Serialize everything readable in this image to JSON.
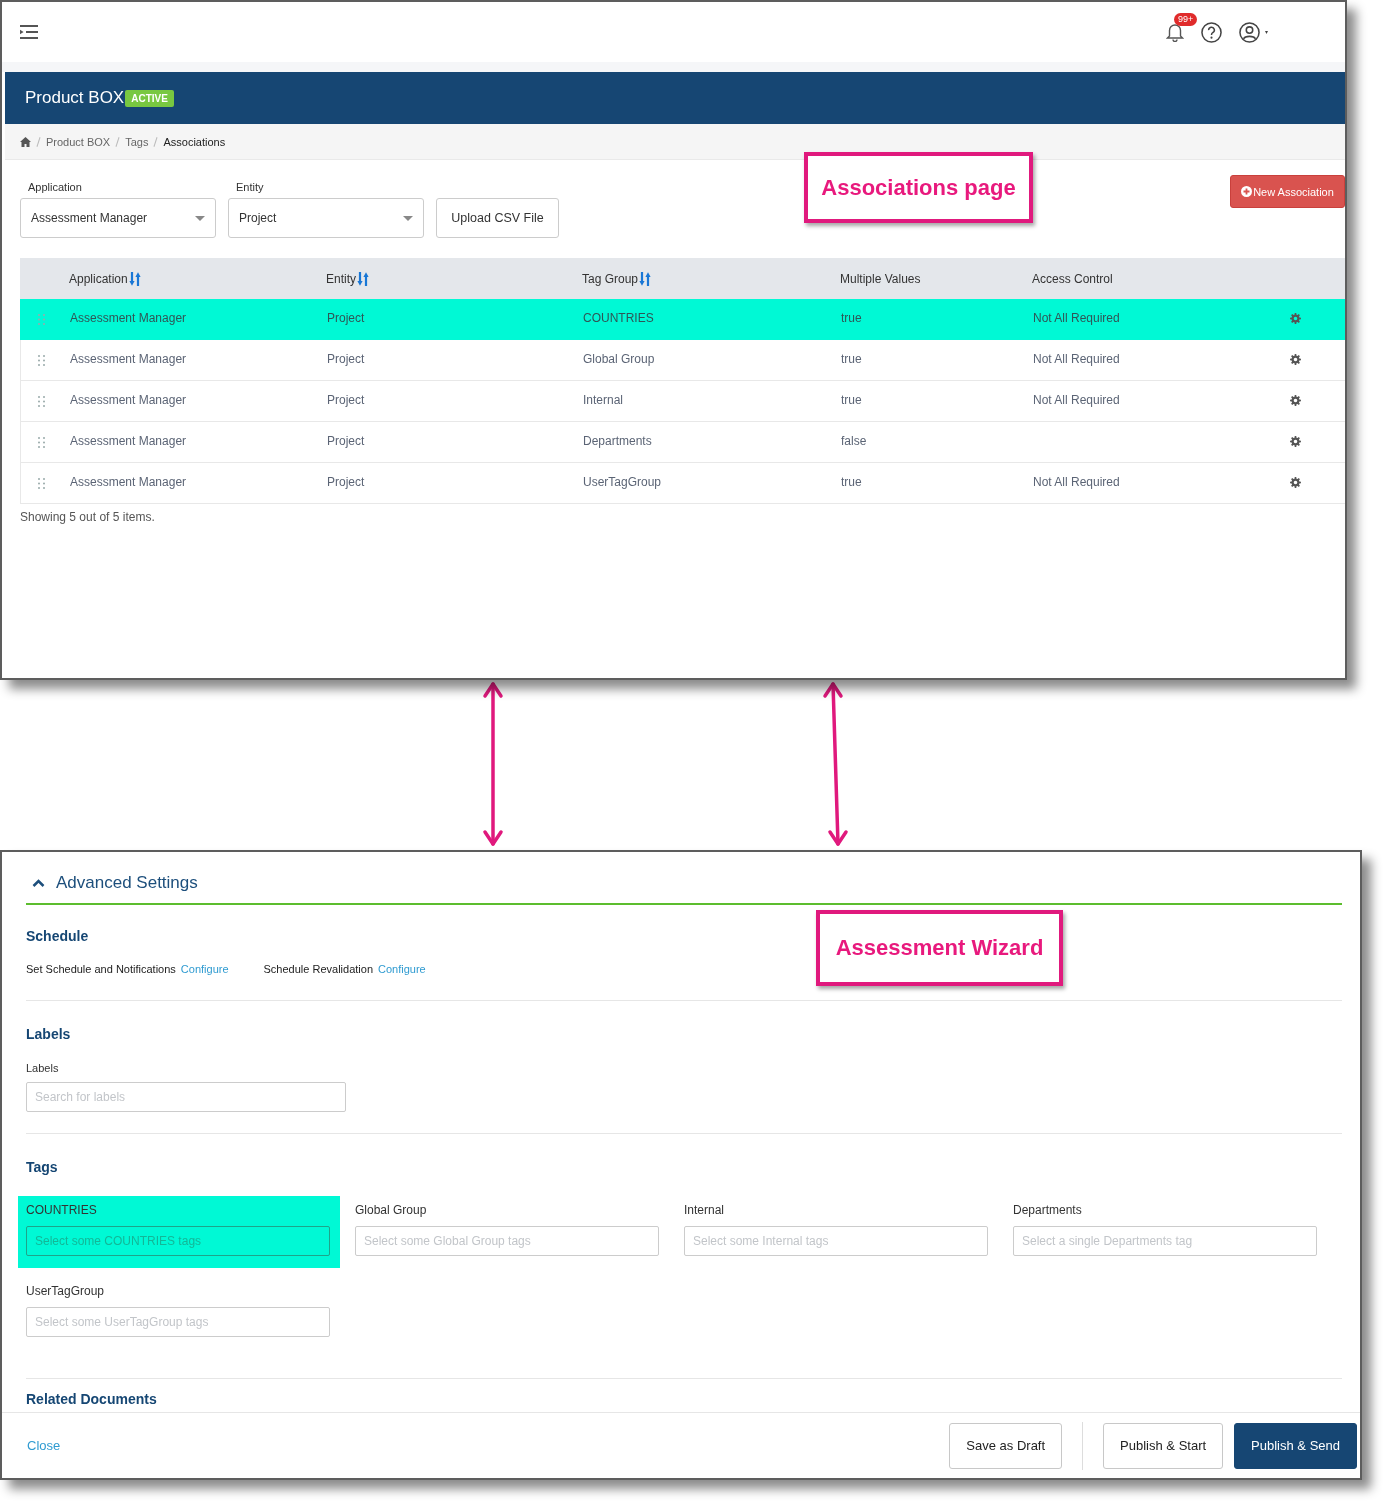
{
  "associations_page": {
    "annotation": "Associations page",
    "top_bar": {
      "notifications_badge": "99+"
    },
    "header": {
      "title": "Product BOX",
      "status": "ACTIVE"
    },
    "breadcrumb": [
      {
        "label": "Product BOX",
        "current": false
      },
      {
        "label": "Tags",
        "current": false
      },
      {
        "label": "Associations",
        "current": true
      }
    ],
    "filters": [
      {
        "label": "Application",
        "value": "Assessment Manager"
      },
      {
        "label": "Entity",
        "value": "Project"
      }
    ],
    "upload_button": "Upload CSV File",
    "new_association_button": "New Association",
    "table": {
      "columns": [
        {
          "label": "Application",
          "sortable": true
        },
        {
          "label": "Entity",
          "sortable": true
        },
        {
          "label": "Tag Group",
          "sortable": true
        },
        {
          "label": "Multiple Values",
          "sortable": false
        },
        {
          "label": "Access Control",
          "sortable": false
        }
      ],
      "rows": [
        {
          "highlighted": true,
          "application": "Assessment Manager",
          "entity": "Project",
          "tag_group": "COUNTRIES",
          "multiple_values": "true",
          "access_control": "Not All Required"
        },
        {
          "highlighted": false,
          "application": "Assessment Manager",
          "entity": "Project",
          "tag_group": "Global Group",
          "multiple_values": "true",
          "access_control": "Not All Required"
        },
        {
          "highlighted": false,
          "application": "Assessment Manager",
          "entity": "Project",
          "tag_group": "Internal",
          "multiple_values": "true",
          "access_control": "Not All Required"
        },
        {
          "highlighted": false,
          "application": "Assessment Manager",
          "entity": "Project",
          "tag_group": "Departments",
          "multiple_values": "false"
        },
        {
          "highlighted": false,
          "application": "Assessment Manager",
          "entity": "Project",
          "tag_group": "UserTagGroup",
          "multiple_values": "true",
          "access_control": "Not All Required"
        }
      ],
      "summary": "Showing 5 out of 5 items."
    }
  },
  "assessment_wizard": {
    "annotation": "Assessment Wizard",
    "section_title": "Advanced Settings",
    "expanded": true,
    "schedule": {
      "heading": "Schedule",
      "items": [
        {
          "label": "Set Schedule and Notifications",
          "link": "Configure"
        },
        {
          "label": "Schedule Revalidation",
          "link": "Configure"
        }
      ]
    },
    "labels": {
      "heading": "Labels",
      "field_label": "Labels",
      "placeholder": "Search for labels"
    },
    "tags": {
      "heading": "Tags",
      "fields": [
        {
          "label": "COUNTRIES",
          "placeholder": "Select some COUNTRIES tags",
          "highlighted": true
        },
        {
          "label": "Global Group",
          "placeholder": "Select some Global Group tags",
          "highlighted": false
        },
        {
          "label": "Internal",
          "placeholder": "Select some Internal tags",
          "highlighted": false
        },
        {
          "label": "Departments",
          "placeholder": "Select a single Departments tag",
          "highlighted": false
        },
        {
          "label": "UserTagGroup",
          "placeholder": "Select some UserTagGroup tags",
          "highlighted": false
        }
      ]
    },
    "related_documents": {
      "heading": "Related Documents"
    },
    "footer": {
      "close_link": "Close",
      "button_groups": [
        [
          {
            "label": "Save as Draft",
            "kind": "secondary"
          }
        ],
        [
          {
            "label": "Publish & Start",
            "kind": "secondary"
          },
          {
            "label": "Publish & Send",
            "kind": "primary"
          }
        ]
      ]
    }
  }
}
